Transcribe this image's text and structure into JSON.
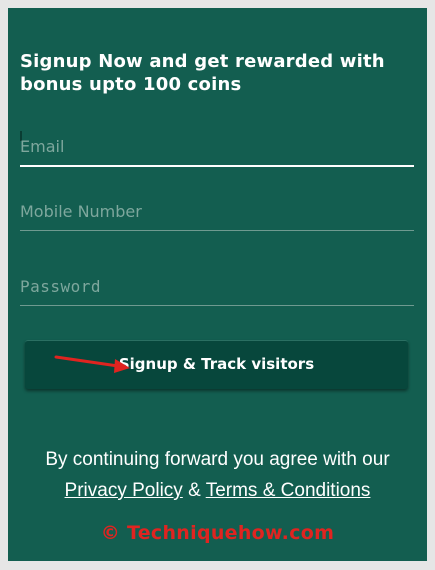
{
  "signup": {
    "heading": "Signup Now and get rewarded with bonus upto 100 coins",
    "email_placeholder": "Email",
    "mobile_placeholder": "Mobile Number",
    "password_placeholder": "Password",
    "button_label": "Signup & Track visitors"
  },
  "footer": {
    "agree_text": "By continuing forward you agree with our",
    "privacy_link": "Privacy Policy",
    "separator": "&",
    "terms_link": "Terms & Conditions"
  },
  "watermark": {
    "text": "© Techniquehow.com"
  },
  "colors": {
    "background": "#135e50",
    "button": "#07473c",
    "annotation_arrow": "#e02420"
  },
  "icons": {
    "annotation": "red-arrow-icon"
  }
}
